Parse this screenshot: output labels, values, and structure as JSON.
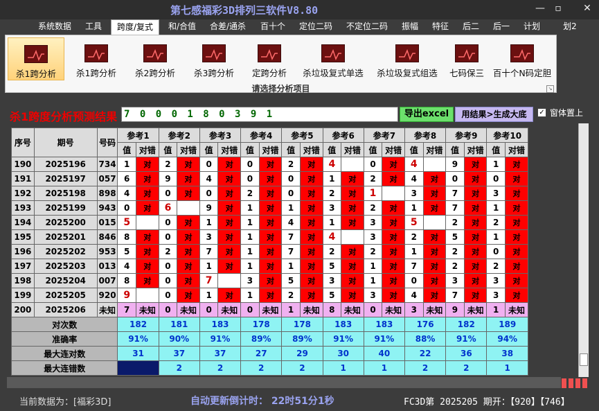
{
  "app_title": "第七感福彩3D排列三软件V8.80",
  "window_controls": {
    "minimize": "—",
    "restore": "▫",
    "close": "✕"
  },
  "menu": [
    "系统数据",
    "工具",
    "跨度/复式",
    "和/合值",
    "合差/通杀",
    "百十个",
    "定位二码",
    "不定位二码",
    "振幅",
    "特征",
    "后二",
    "后一",
    "计划",
    "划2"
  ],
  "ribbon": {
    "buttons": [
      "杀1跨分析",
      "杀1跨分析",
      "杀2跨分析",
      "杀3跨分析",
      "定跨分析",
      "杀垃圾复式单选",
      "杀垃圾复式组选",
      "七码保三",
      "百十个N码定胆"
    ],
    "caption": "请选择分析项目"
  },
  "panel": {
    "title": "杀1跨度分析预测结果",
    "result": "7 0 0 0 1 8 0 3 9 1",
    "export_button": "导出excel",
    "generate_button": "用结果>生成大底",
    "checkbox_mark": "✓",
    "checkbox_label": "窗体置上"
  },
  "table": {
    "header_fixed": [
      "序号",
      "期号",
      "号码"
    ],
    "ref_headers": [
      "参考1",
      "参考2",
      "参考3",
      "参考4",
      "参考5",
      "参考6",
      "参考7",
      "参考8",
      "参考9",
      "参考10"
    ],
    "sub_value": "值",
    "sub_match": "对错",
    "dui": "对",
    "rows": [
      {
        "seq": "190",
        "issue": "2025196",
        "num": "734",
        "refs": [
          [
            "1",
            "对"
          ],
          [
            "2",
            "对"
          ],
          [
            "0",
            "对"
          ],
          [
            "0",
            "对"
          ],
          [
            "2",
            "对"
          ],
          [
            "4",
            ""
          ],
          [
            "0",
            "对"
          ],
          [
            "4",
            ""
          ],
          [
            "9",
            "对"
          ],
          [
            "1",
            "对"
          ]
        ]
      },
      {
        "seq": "191",
        "issue": "2025197",
        "num": "057",
        "refs": [
          [
            "6",
            "对"
          ],
          [
            "9",
            "对"
          ],
          [
            "4",
            "对"
          ],
          [
            "0",
            "对"
          ],
          [
            "0",
            "对"
          ],
          [
            "1",
            "对"
          ],
          [
            "2",
            "对"
          ],
          [
            "4",
            "对"
          ],
          [
            "0",
            "对"
          ],
          [
            "0",
            "对"
          ]
        ]
      },
      {
        "seq": "192",
        "issue": "2025198",
        "num": "898",
        "refs": [
          [
            "4",
            "对"
          ],
          [
            "0",
            "对"
          ],
          [
            "0",
            "对"
          ],
          [
            "2",
            "对"
          ],
          [
            "0",
            "对"
          ],
          [
            "2",
            "对"
          ],
          [
            "1",
            ""
          ],
          [
            "3",
            "对"
          ],
          [
            "7",
            "对"
          ],
          [
            "3",
            "对"
          ]
        ]
      },
      {
        "seq": "193",
        "issue": "2025199",
        "num": "943",
        "refs": [
          [
            "0",
            "对"
          ],
          [
            "6",
            ""
          ],
          [
            "9",
            "对"
          ],
          [
            "1",
            "对"
          ],
          [
            "1",
            "对"
          ],
          [
            "3",
            "对"
          ],
          [
            "2",
            "对"
          ],
          [
            "1",
            "对"
          ],
          [
            "7",
            "对"
          ],
          [
            "1",
            "对"
          ]
        ]
      },
      {
        "seq": "194",
        "issue": "2025200",
        "num": "015",
        "refs": [
          [
            "5",
            ""
          ],
          [
            "0",
            "对"
          ],
          [
            "1",
            "对"
          ],
          [
            "1",
            "对"
          ],
          [
            "4",
            "对"
          ],
          [
            "1",
            "对"
          ],
          [
            "3",
            "对"
          ],
          [
            "5",
            ""
          ],
          [
            "2",
            "对"
          ],
          [
            "2",
            "对"
          ]
        ]
      },
      {
        "seq": "195",
        "issue": "2025201",
        "num": "846",
        "refs": [
          [
            "8",
            "对"
          ],
          [
            "0",
            "对"
          ],
          [
            "3",
            "对"
          ],
          [
            "1",
            "对"
          ],
          [
            "7",
            "对"
          ],
          [
            "4",
            ""
          ],
          [
            "3",
            "对"
          ],
          [
            "2",
            "对"
          ],
          [
            "5",
            "对"
          ],
          [
            "1",
            "对"
          ]
        ]
      },
      {
        "seq": "196",
        "issue": "2025202",
        "num": "953",
        "refs": [
          [
            "5",
            "对"
          ],
          [
            "2",
            "对"
          ],
          [
            "7",
            "对"
          ],
          [
            "1",
            "对"
          ],
          [
            "7",
            "对"
          ],
          [
            "2",
            "对"
          ],
          [
            "2",
            "对"
          ],
          [
            "1",
            "对"
          ],
          [
            "2",
            "对"
          ],
          [
            "0",
            "对"
          ]
        ]
      },
      {
        "seq": "197",
        "issue": "2025203",
        "num": "013",
        "refs": [
          [
            "4",
            "对"
          ],
          [
            "0",
            "对"
          ],
          [
            "1",
            "对"
          ],
          [
            "1",
            "对"
          ],
          [
            "1",
            "对"
          ],
          [
            "5",
            "对"
          ],
          [
            "1",
            "对"
          ],
          [
            "7",
            "对"
          ],
          [
            "2",
            "对"
          ],
          [
            "2",
            "对"
          ]
        ]
      },
      {
        "seq": "198",
        "issue": "2025204",
        "num": "007",
        "refs": [
          [
            "8",
            "对"
          ],
          [
            "0",
            "对"
          ],
          [
            "7",
            ""
          ],
          [
            "3",
            "对"
          ],
          [
            "5",
            "对"
          ],
          [
            "3",
            "对"
          ],
          [
            "1",
            "对"
          ],
          [
            "0",
            "对"
          ],
          [
            "3",
            "对"
          ],
          [
            "3",
            "对"
          ]
        ]
      },
      {
        "seq": "199",
        "issue": "2025205",
        "num": "920",
        "refs": [
          [
            "9",
            ""
          ],
          [
            "0",
            "对"
          ],
          [
            "1",
            "对"
          ],
          [
            "1",
            "对"
          ],
          [
            "2",
            "对"
          ],
          [
            "5",
            "对"
          ],
          [
            "3",
            "对"
          ],
          [
            "4",
            "对"
          ],
          [
            "7",
            "对"
          ],
          [
            "3",
            "对"
          ]
        ]
      }
    ],
    "pred_row": {
      "seq": "200",
      "issue": "2025206",
      "num": "未知",
      "values": [
        "7",
        "0",
        "0",
        "0",
        "1",
        "8",
        "0",
        "3",
        "9",
        "1"
      ],
      "match": "未知"
    },
    "stats": [
      {
        "label": "对次数",
        "values": [
          "182",
          "181",
          "183",
          "178",
          "178",
          "183",
          "183",
          "176",
          "182",
          "189"
        ]
      },
      {
        "label": "准确率",
        "values": [
          "91%",
          "90%",
          "91%",
          "89%",
          "89%",
          "91%",
          "91%",
          "88%",
          "91%",
          "94%"
        ]
      },
      {
        "label": "最大连对数",
        "values": [
          "31",
          "37",
          "37",
          "27",
          "29",
          "30",
          "40",
          "22",
          "36",
          "38"
        ]
      },
      {
        "label": "最大连错数",
        "values": [
          "",
          "2",
          "2",
          "2",
          "2",
          "1",
          "1",
          "2",
          "2",
          "1"
        ]
      }
    ]
  },
  "status": {
    "current_data": "当前数据为：[福彩3D]",
    "countdown": "自动更新倒计时：  22时51分1秒",
    "draw_info": "FC3D第 2025205 期开：【920】【746】"
  }
}
